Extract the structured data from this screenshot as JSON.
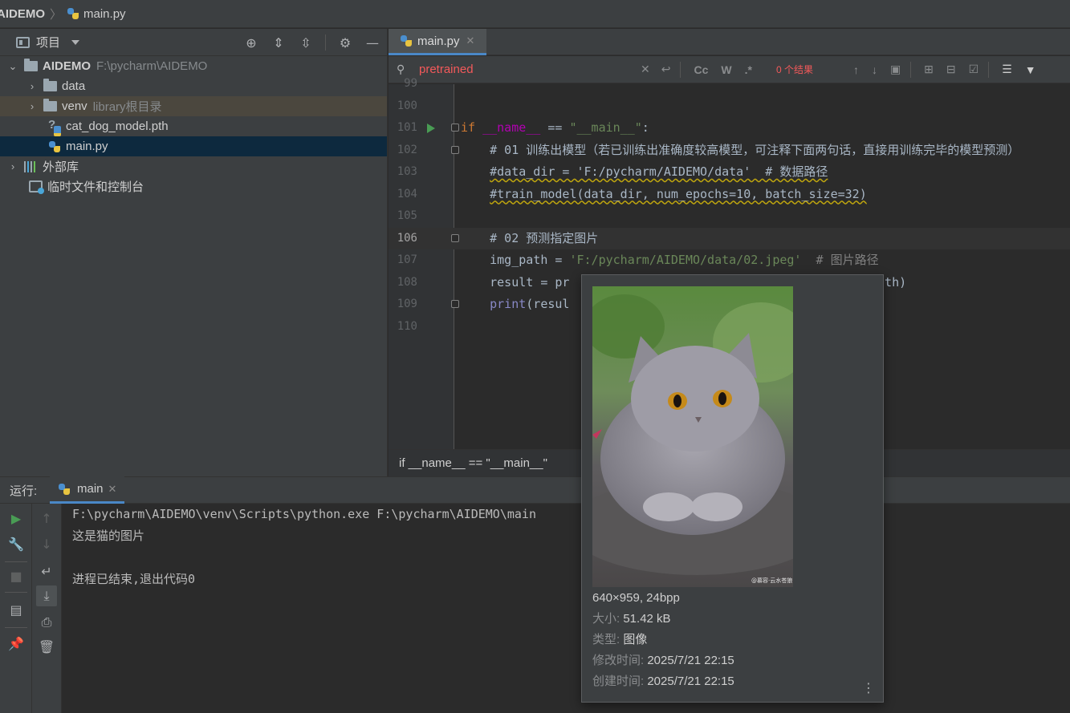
{
  "navbar": {
    "project": "AIDEMO",
    "file": "main.py"
  },
  "project_panel": {
    "title": "项目",
    "tree": [
      {
        "name": "AIDEMO",
        "hint": "F:\\pycharm\\AIDEMO",
        "type": "folder",
        "expanded": true
      },
      {
        "name": "data",
        "hint": "",
        "type": "folder"
      },
      {
        "name": "venv",
        "hint": "library根目录",
        "type": "folder"
      },
      {
        "name": "cat_dog_model.pth",
        "hint": "",
        "type": "file"
      },
      {
        "name": "main.py",
        "hint": "",
        "type": "python-file",
        "selected": true
      },
      {
        "name": "外部库",
        "hint": "",
        "type": "library"
      },
      {
        "name": "临时文件和控制台",
        "hint": "",
        "type": "scratches"
      }
    ]
  },
  "editor": {
    "tab_label": "main.py",
    "search": {
      "query": "pretrained",
      "results": "0 个结果",
      "options": [
        "Cc",
        "W",
        ".*"
      ]
    },
    "lines": [
      {
        "num": "99",
        "code": ""
      },
      {
        "num": "100",
        "code": ""
      },
      {
        "num": "101",
        "code": "if __name__ == \"__main__\":"
      },
      {
        "num": "102",
        "code": "    # 01 训练出模型（若已训练出准确度较高模型，可注释下面两句话，直接用训练完毕的模型预测）"
      },
      {
        "num": "103",
        "code": "    #data_dir = 'F:/pycharm/AIDEMO/data'  # 数据路径"
      },
      {
        "num": "104",
        "code": "    #train_model(data_dir, num_epochs=10, batch_size=32)"
      },
      {
        "num": "105",
        "code": ""
      },
      {
        "num": "106",
        "code": "    # 02 预测指定图片"
      },
      {
        "num": "107",
        "code": "    img_path = 'F:/pycharm/AIDEMO/data/02.jpeg'  # 图片路径"
      },
      {
        "num": "108",
        "code": "    result = pr"
      },
      {
        "num": "109",
        "code": "    print(resul"
      },
      {
        "num": "110",
        "code": ""
      }
    ],
    "line108_tail": "path)",
    "breadcrumb": "if __name__ == \"__main__\""
  },
  "run_panel": {
    "label": "运行:",
    "tab": "main",
    "console": [
      "F:\\pycharm\\AIDEMO\\venv\\Scripts\\python.exe F:\\pycharm\\AIDEMO\\main",
      "这是猫的图片",
      "",
      "进程已结束,退出代码0"
    ]
  },
  "image_popup": {
    "dimensions": "640×959, 24bpp",
    "size_label": "大小:",
    "size_value": "51.42 kB",
    "type_label": "类型:",
    "type_value": "图像",
    "modified_label": "修改时间:",
    "modified_value": "2025/7/21 22:15",
    "created_label": "创建时间:",
    "created_value": "2025/7/21 22:15",
    "watermark": "@慕容·云水苍狼"
  },
  "colors": {
    "accent": "#4a88c7",
    "search_text": "#f3595a",
    "run_green": "#499c54",
    "string": "#6a8759",
    "keyword": "#cc7832",
    "comment": "#808080"
  }
}
